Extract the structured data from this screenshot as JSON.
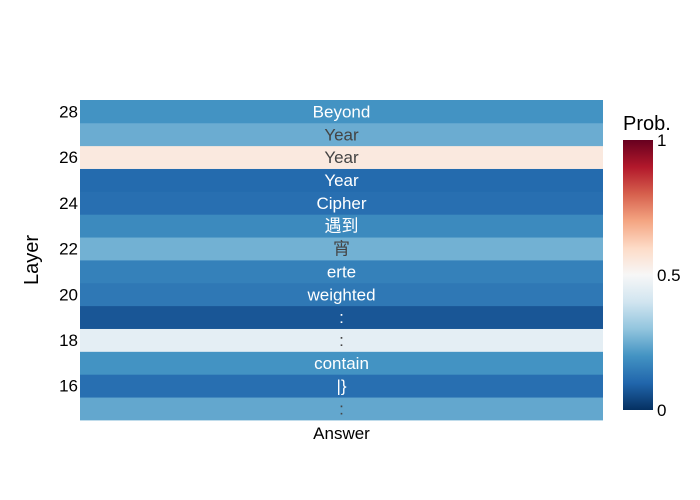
{
  "chart_data": {
    "type": "heatmap",
    "title": "",
    "xlabel": "",
    "ylabel": "Layer",
    "x": [
      "Answer"
    ],
    "y": [
      15,
      16,
      17,
      18,
      19,
      20,
      21,
      22,
      23,
      24,
      25,
      26,
      27,
      28
    ],
    "ytick_labels": [
      "16",
      "18",
      "20",
      "22",
      "24",
      "26",
      "28"
    ],
    "ytick_values": [
      16,
      18,
      20,
      22,
      24,
      26,
      28
    ],
    "cells": [
      {
        "layer": 15,
        "text": ":",
        "prob": 0.24
      },
      {
        "layer": 16,
        "text": "|}",
        "prob": 0.12
      },
      {
        "layer": 17,
        "text": "contain",
        "prob": 0.2
      },
      {
        "layer": 18,
        "text": ":",
        "prob": 0.45
      },
      {
        "layer": 19,
        "text": ":",
        "prob": 0.07
      },
      {
        "layer": 20,
        "text": "weighted",
        "prob": 0.14
      },
      {
        "layer": 21,
        "text": "erte",
        "prob": 0.16
      },
      {
        "layer": 22,
        "text": "宵",
        "prob": 0.26
      },
      {
        "layer": 23,
        "text": "遇到",
        "prob": 0.18
      },
      {
        "layer": 24,
        "text": "Cipher",
        "prob": 0.12
      },
      {
        "layer": 25,
        "text": "Year",
        "prob": 0.11
      },
      {
        "layer": 26,
        "text": "Year",
        "prob": 0.55
      },
      {
        "layer": 27,
        "text": "Year",
        "prob": 0.25
      },
      {
        "layer": 28,
        "text": "Beyond",
        "prob": 0.2
      }
    ],
    "colorbar": {
      "title": "Prob.",
      "range": [
        0,
        1
      ],
      "tick_values": [
        0,
        0.5,
        1
      ],
      "tick_labels": [
        "0",
        "0.5",
        "1"
      ],
      "colorscale": [
        "#053061",
        "#2166ac",
        "#4393c3",
        "#92c5de",
        "#d1e5f0",
        "#f7f7f7",
        "#fddbc7",
        "#f4a582",
        "#d6604d",
        "#b2182b",
        "#67001f"
      ]
    },
    "grid": false
  }
}
